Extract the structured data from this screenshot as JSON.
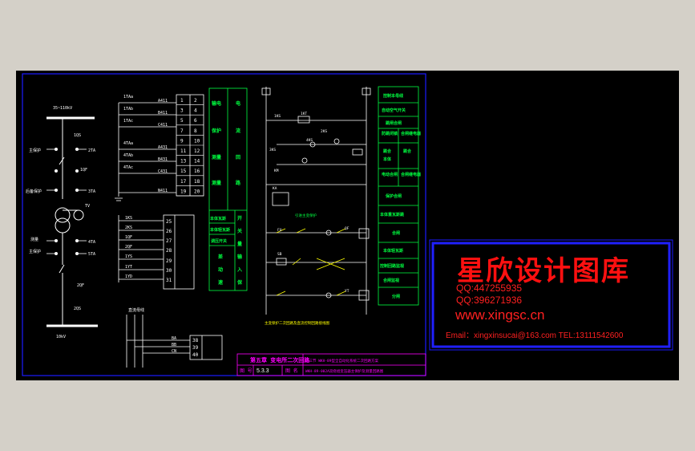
{
  "title_block": {
    "chapter": "第五章 变电所二次回路",
    "section": "第三节 WKH-89型全自动化系统二次回路方案",
    "drawing_no_label": "图 号",
    "drawing_no": "5.3.3",
    "drawing_name_label": "图 名",
    "drawing_name": "WKH-89-002A双绕组变压器主保护及测量回路图"
  },
  "primary": {
    "bus_high": "35~110kV",
    "bus_low": "10kV",
    "labels": [
      "主保护",
      "后备保护",
      "测量",
      "主保护",
      "1QS",
      "1QF",
      "2TA",
      "3TA",
      "TV",
      "4TA",
      "5TA",
      "2QF",
      "2QS"
    ]
  },
  "ct_inputs": [
    "1TAa",
    "1TAb",
    "1TAc",
    "4TAa",
    "4TAb",
    "4TAc"
  ],
  "ct_terminals": [
    "A411",
    "B411",
    "C411",
    "A431",
    "B431",
    "C431",
    "N411"
  ],
  "terminal_numbers": [
    "1",
    "2",
    "3",
    "4",
    "5",
    "6",
    "7",
    "8",
    "9",
    "10",
    "11",
    "12",
    "13",
    "14",
    "15",
    "16",
    "17",
    "18",
    "19",
    "20"
  ],
  "signal_inputs": [
    "1KS",
    "2KS",
    "1QF",
    "2QF",
    "1YS",
    "1YT",
    "1YD"
  ],
  "signal_terminals": [
    "25",
    "26",
    "27",
    "28",
    "29",
    "30",
    "31"
  ],
  "dc_inputs": [
    "BA",
    "BB",
    "CN"
  ],
  "dc_terminals": [
    "38",
    "39",
    "40"
  ],
  "dc_label": "直流母线",
  "green_panel": {
    "rows": [
      "输电",
      "电",
      "保护",
      "流",
      "测量",
      "回",
      "测量",
      "路",
      "本体瓦斯",
      "开",
      "本体轻瓦斯",
      "关",
      "调压开关",
      "量",
      "差",
      "输",
      "动",
      "入",
      "速",
      "保"
    ]
  },
  "control_labels": [
    "1KS",
    "1KT",
    "2KS",
    "3KS",
    "4KS",
    "KM",
    "KA",
    "FU",
    "SB",
    "QF",
    "YT"
  ],
  "control_note": "引进主变保护",
  "control_footer": "主变保护二次回路及直流控制回路接线图",
  "legend": [
    "控制本母线",
    "自动空气开关",
    "跳闸合闸",
    "防跳闭锁",
    "合闸继电器",
    "跳合",
    "本体",
    "跳合",
    "电动合闸",
    "合闸继电器",
    "保护合闸",
    "本体重瓦斯跳",
    "合闸",
    "本体轻瓦斯",
    "控制回路监视",
    "合闸监视",
    "分闸"
  ],
  "watermark": {
    "title": "星欣设计图库",
    "qq1": "QQ:447255935",
    "qq2": "QQ:396271936",
    "website": "www.xingsc.cn",
    "contact": "Email：xingxinsucai@163.com  TEL:13111542600"
  },
  "colors": {
    "background": "#000000",
    "frame": "#1a1aff",
    "line": "#ffffff",
    "green": "#00ff40",
    "magenta": "#ff00ff",
    "yellow": "#ffff00",
    "red": "#ff2020",
    "cyan": "#00ffff"
  }
}
